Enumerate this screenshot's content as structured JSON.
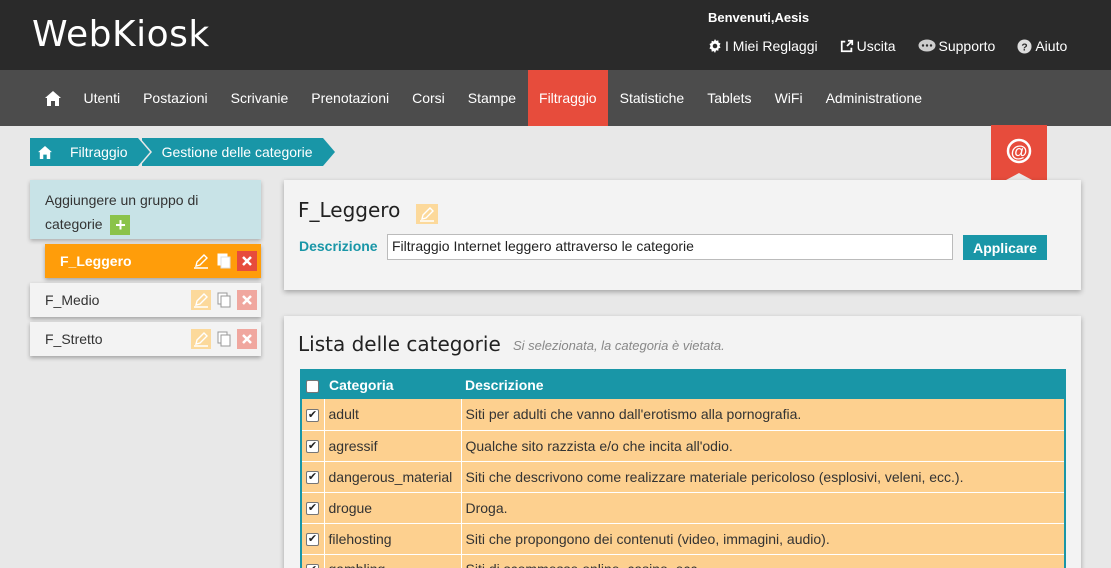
{
  "header": {
    "logo": "WebKiosk",
    "welcome": "Benvenuti,Aesis",
    "links": [
      {
        "label": "I Miei Reglaggi",
        "icon": "gear-icon"
      },
      {
        "label": "Uscita",
        "icon": "external-link-icon"
      },
      {
        "label": "Supporto",
        "icon": "chat-icon"
      },
      {
        "label": "Aiuto",
        "icon": "help-icon"
      }
    ]
  },
  "nav": {
    "items": [
      "Utenti",
      "Postazioni",
      "Scrivanie",
      "Prenotazioni",
      "Corsi",
      "Stampe",
      "Filtraggio",
      "Statistiche",
      "Tablets",
      "WiFi",
      "Administratione"
    ],
    "active": "Filtraggio",
    "active_color": "#e74c3c"
  },
  "breadcrumb": {
    "items": [
      "Filtraggio",
      "Gestione delle categorie"
    ]
  },
  "sidebar": {
    "add_group_label": "Aggiungere un gruppo di categorie",
    "add_icon": "+",
    "groups": [
      {
        "name": "F_Leggero",
        "active": true
      },
      {
        "name": "F_Medio",
        "active": false
      },
      {
        "name": "F_Stretto",
        "active": false
      }
    ]
  },
  "editor": {
    "title": "F_Leggero",
    "description_label": "Descrizione",
    "description_value": "Filtraggio Internet leggero attraverso le categorie",
    "apply_label": "Applicare"
  },
  "categories": {
    "title": "Lista delle categorie",
    "subtitle": "Si selezionata, la categoria è vietata.",
    "columns": [
      "Categoria",
      "Descrizione"
    ],
    "rows": [
      {
        "name": "adult",
        "description": "Siti per adulti che vanno dall'erotismo alla pornografia.",
        "checked": true
      },
      {
        "name": "agressif",
        "description": "Qualche sito razzista e/o che incita all'odio.",
        "checked": true
      },
      {
        "name": "dangerous_material",
        "description": "Siti che descrivono come realizzare materiale pericoloso (esplosivi, veleni, ecc.).",
        "checked": true
      },
      {
        "name": "drogue",
        "description": "Droga.",
        "checked": true
      },
      {
        "name": "filehosting",
        "description": "Siti che propongono dei contenuti (video, immagini, audio).",
        "checked": true
      },
      {
        "name": "gambling",
        "description": "Siti di scommesse online, casino, ecc.",
        "checked": true
      }
    ]
  },
  "colors": {
    "accent": "#1996a7",
    "active_group": "#ff9d0a",
    "row_bg": "#fdd08f",
    "header_bg": "#2a2a2a",
    "nav_bg": "#4c4c4c"
  }
}
